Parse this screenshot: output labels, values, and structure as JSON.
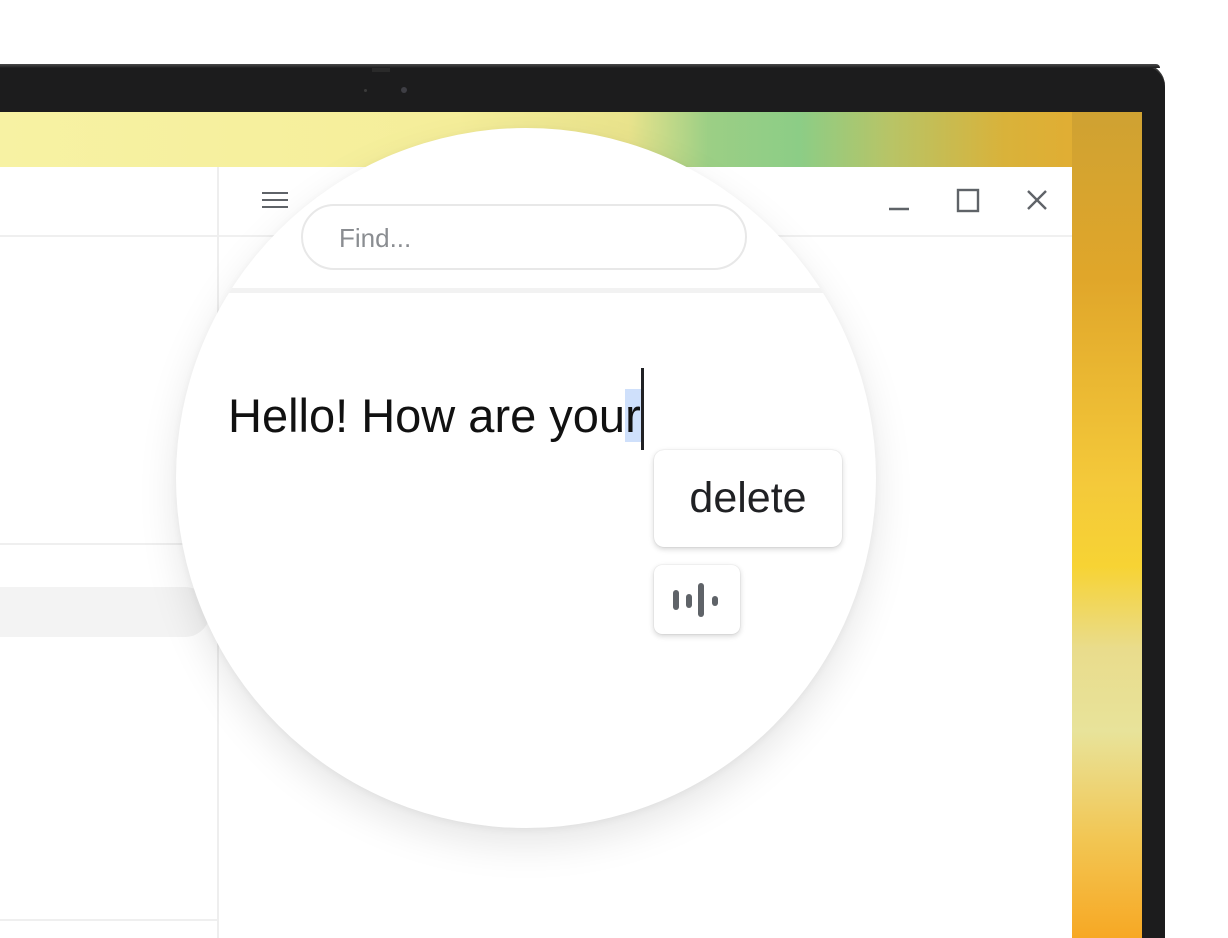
{
  "window": {
    "menu_icon": "hamburger-menu-icon",
    "minimize_icon": "minimize-icon",
    "maximize_icon": "maximize-icon",
    "close_icon": "close-icon"
  },
  "magnifier": {
    "search": {
      "placeholder": "Find...",
      "value": ""
    },
    "editor": {
      "text_before_selection": "Hello! How are you",
      "selected_text": "r"
    },
    "suggestion": {
      "label": "delete"
    },
    "dictation_icon": "voice-waveform-icon"
  },
  "colors": {
    "selection": "#cfe0fb",
    "bezel": "#1c1c1d"
  }
}
